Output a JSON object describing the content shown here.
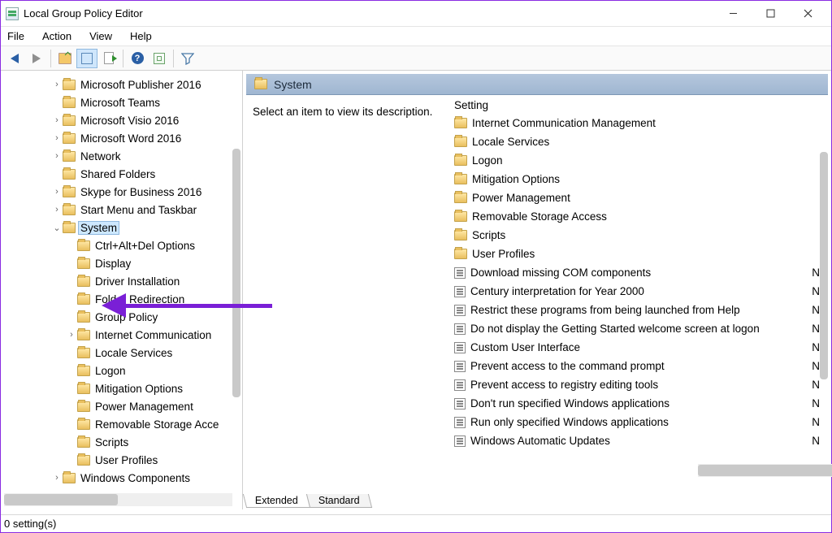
{
  "window": {
    "title": "Local Group Policy Editor"
  },
  "menubar": {
    "file": "File",
    "action": "Action",
    "view": "View",
    "help": "Help"
  },
  "tree": {
    "items": [
      {
        "label": "Microsoft Publisher 2016",
        "depth": 2,
        "twisty": ">"
      },
      {
        "label": "Microsoft Teams",
        "depth": 2,
        "twisty": ""
      },
      {
        "label": "Microsoft Visio 2016",
        "depth": 2,
        "twisty": ">"
      },
      {
        "label": "Microsoft Word 2016",
        "depth": 2,
        "twisty": ">"
      },
      {
        "label": "Network",
        "depth": 2,
        "twisty": ">"
      },
      {
        "label": "Shared Folders",
        "depth": 2,
        "twisty": ""
      },
      {
        "label": "Skype for Business 2016",
        "depth": 2,
        "twisty": ">"
      },
      {
        "label": "Start Menu and Taskbar",
        "depth": 2,
        "twisty": ">"
      },
      {
        "label": "System",
        "depth": 2,
        "twisty": "v",
        "selected": true
      },
      {
        "label": "Ctrl+Alt+Del Options",
        "depth": 3,
        "twisty": ""
      },
      {
        "label": "Display",
        "depth": 3,
        "twisty": ""
      },
      {
        "label": "Driver Installation",
        "depth": 3,
        "twisty": ""
      },
      {
        "label": "Folder Redirection",
        "depth": 3,
        "twisty": ""
      },
      {
        "label": "Group Policy",
        "depth": 3,
        "twisty": ""
      },
      {
        "label": "Internet Communication",
        "depth": 3,
        "twisty": ">"
      },
      {
        "label": "Locale Services",
        "depth": 3,
        "twisty": ""
      },
      {
        "label": "Logon",
        "depth": 3,
        "twisty": ""
      },
      {
        "label": "Mitigation Options",
        "depth": 3,
        "twisty": ""
      },
      {
        "label": "Power Management",
        "depth": 3,
        "twisty": ""
      },
      {
        "label": "Removable Storage Acce",
        "depth": 3,
        "twisty": ""
      },
      {
        "label": "Scripts",
        "depth": 3,
        "twisty": ""
      },
      {
        "label": "User Profiles",
        "depth": 3,
        "twisty": ""
      },
      {
        "label": "Windows Components",
        "depth": 2,
        "twisty": ">"
      }
    ]
  },
  "right": {
    "header": "System",
    "description": "Select an item to view its description.",
    "column_header": "Setting",
    "items": [
      {
        "type": "folder",
        "label": "Internet Communication Management"
      },
      {
        "type": "folder",
        "label": "Locale Services"
      },
      {
        "type": "folder",
        "label": "Logon"
      },
      {
        "type": "folder",
        "label": "Mitigation Options"
      },
      {
        "type": "folder",
        "label": "Power Management"
      },
      {
        "type": "folder",
        "label": "Removable Storage Access"
      },
      {
        "type": "folder",
        "label": "Scripts"
      },
      {
        "type": "folder",
        "label": "User Profiles"
      },
      {
        "type": "setting",
        "label": "Download missing COM components",
        "state": "N"
      },
      {
        "type": "setting",
        "label": "Century interpretation for Year 2000",
        "state": "N"
      },
      {
        "type": "setting",
        "label": "Restrict these programs from being launched from Help",
        "state": "N"
      },
      {
        "type": "setting",
        "label": "Do not display the Getting Started welcome screen at logon",
        "state": "N"
      },
      {
        "type": "setting",
        "label": "Custom User Interface",
        "state": "N"
      },
      {
        "type": "setting",
        "label": "Prevent access to the command prompt",
        "state": "N"
      },
      {
        "type": "setting",
        "label": "Prevent access to registry editing tools",
        "state": "N"
      },
      {
        "type": "setting",
        "label": "Don't run specified Windows applications",
        "state": "N"
      },
      {
        "type": "setting",
        "label": "Run only specified Windows applications",
        "state": "N"
      },
      {
        "type": "setting",
        "label": "Windows Automatic Updates",
        "state": "N"
      }
    ]
  },
  "tabs": {
    "extended": "Extended",
    "standard": "Standard"
  },
  "statusbar": {
    "text": "0 setting(s)"
  }
}
